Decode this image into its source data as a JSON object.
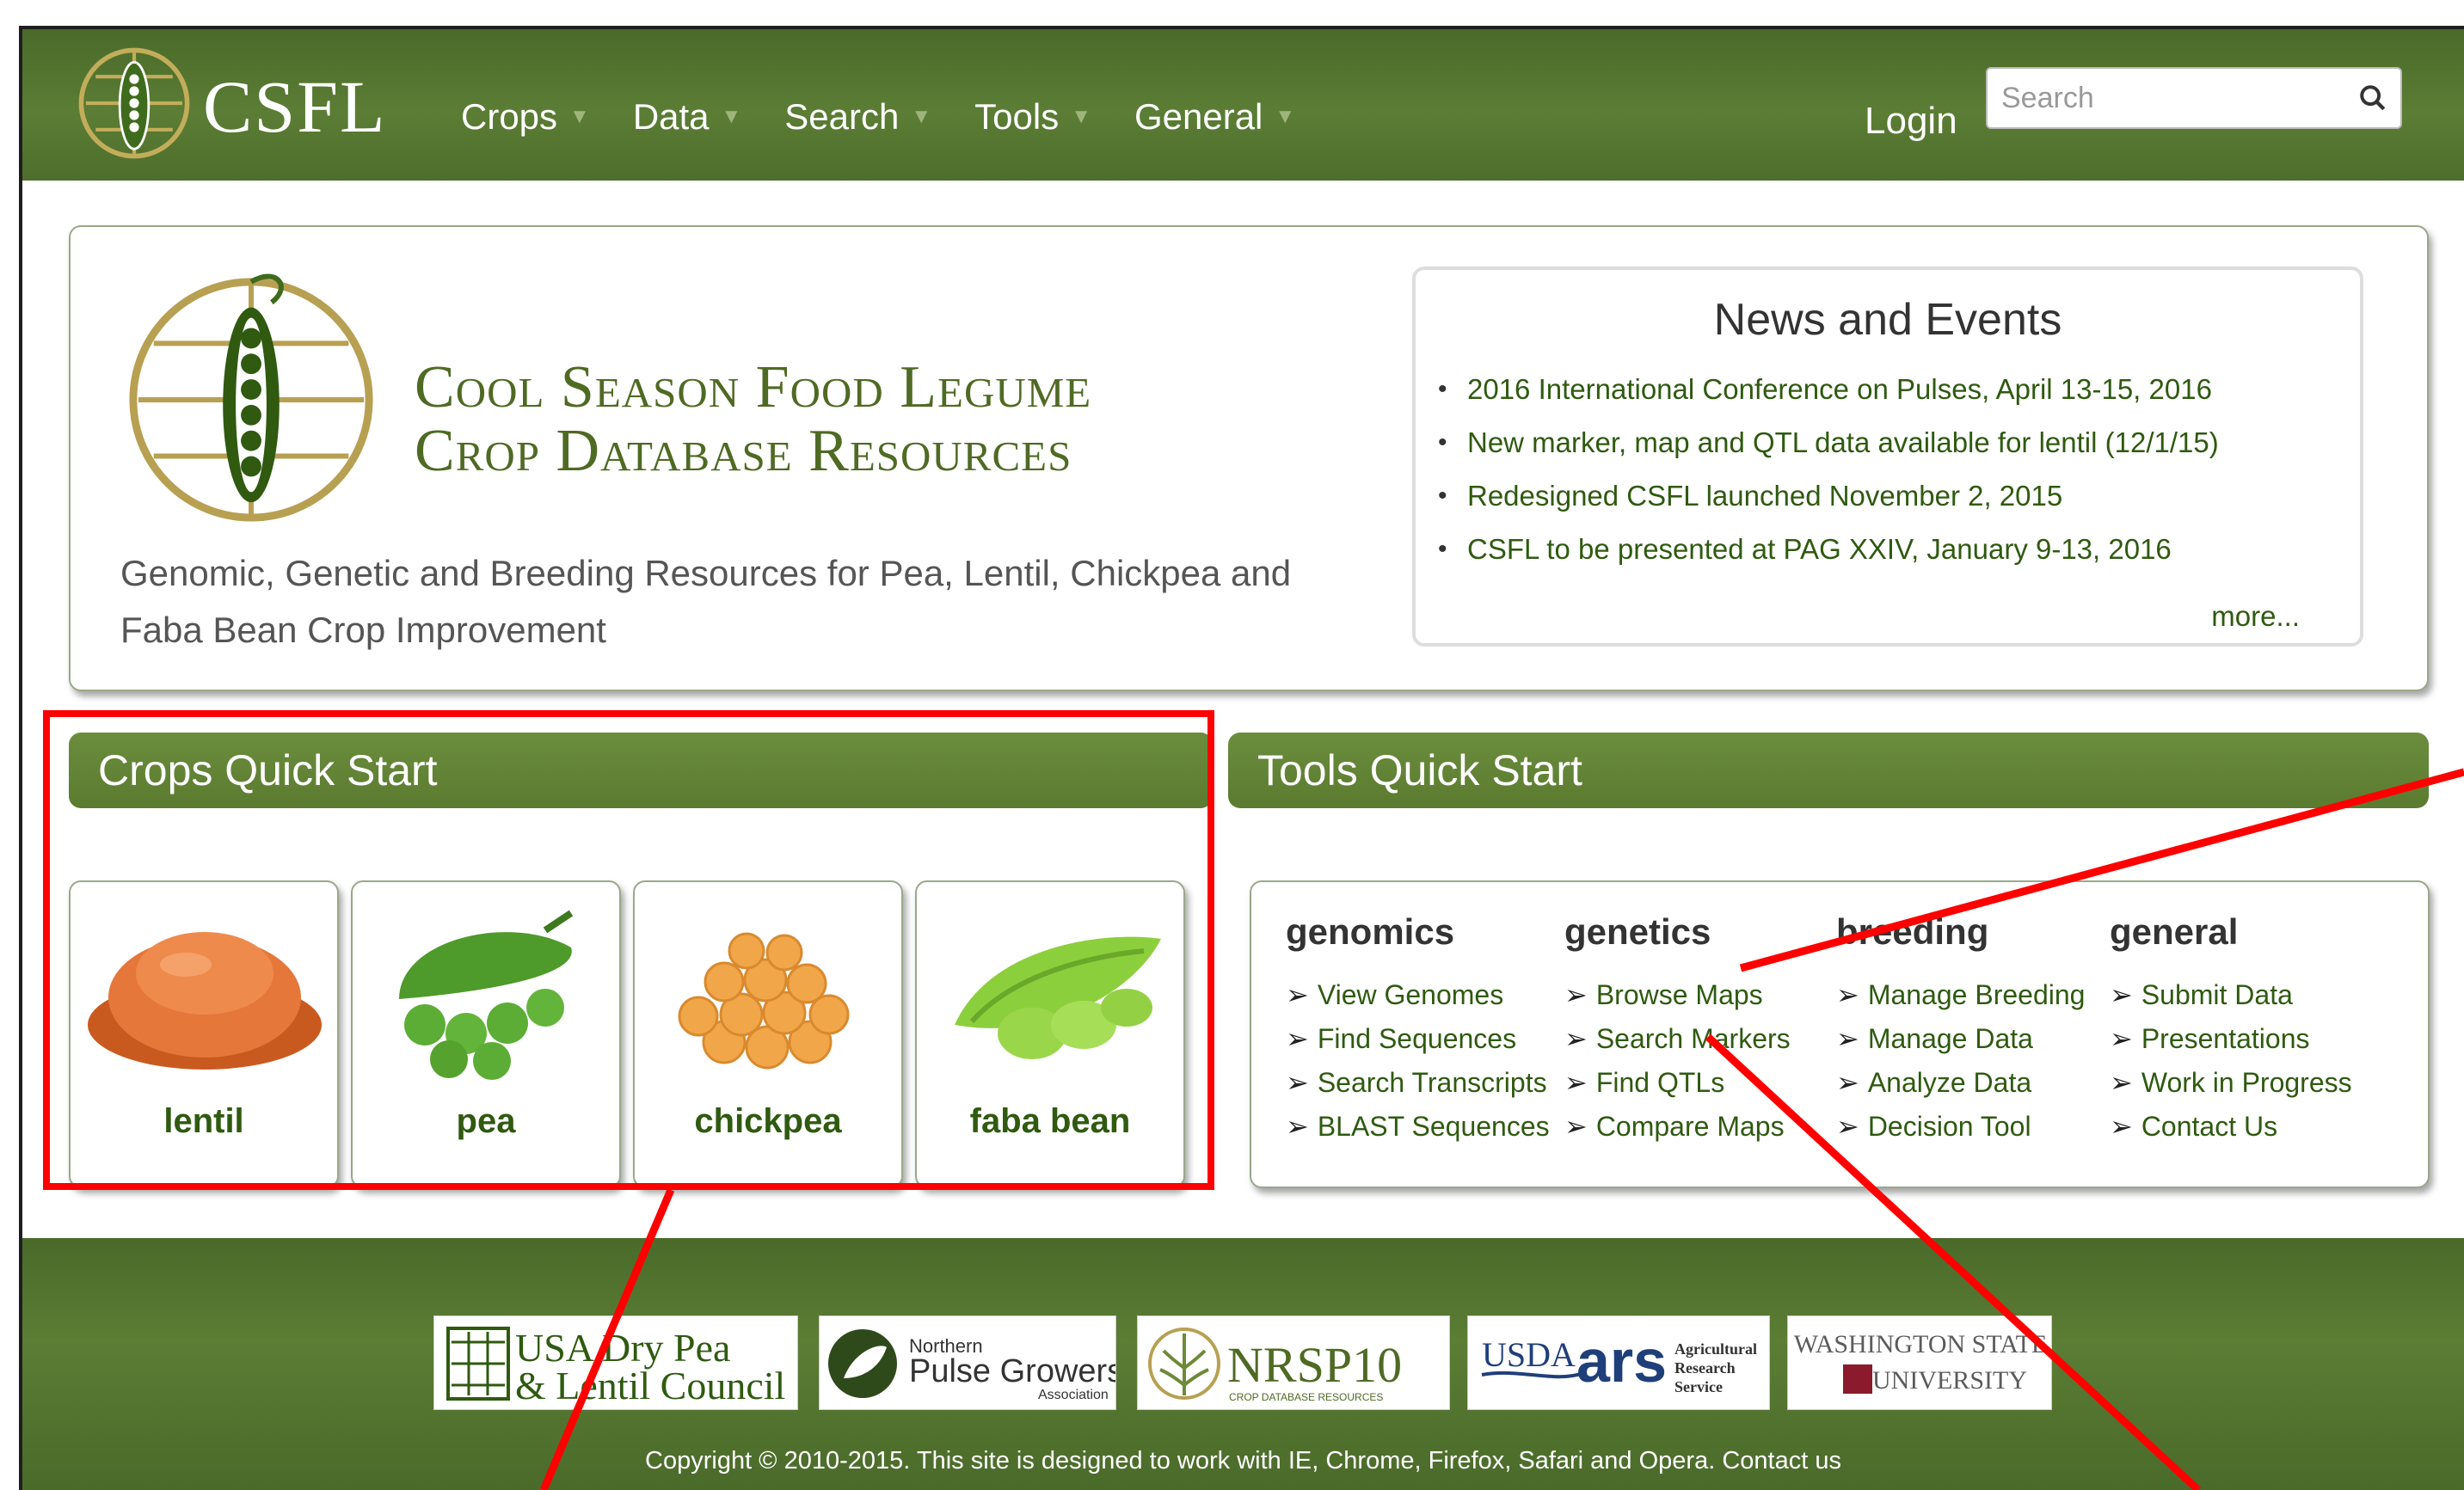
{
  "navbar": {
    "brand": "CSFL",
    "menu": [
      "Crops",
      "Data",
      "Search",
      "Tools",
      "General"
    ],
    "login": "Login",
    "search_placeholder": "Search"
  },
  "hero": {
    "title_line1": "Cool Season Food Legume",
    "title_line2": "Crop Database Resources",
    "tagline": "Genomic, Genetic and Breeding Resources for Pea, Lentil, Chickpea and Faba Bean Crop Improvement"
  },
  "news": {
    "title": "News and Events",
    "items": [
      "2016 International Conference on Pulses, April 13-15, 2016",
      "New marker, map and QTL data available for lentil (12/1/15)",
      "Redesigned CSFL launched November 2, 2015",
      "CSFL to be presented at PAG XXIV, January 9-13, 2016"
    ],
    "more": "more..."
  },
  "crops_quick_start": {
    "title": "Crops Quick Start",
    "crops": [
      "lentil",
      "pea",
      "chickpea",
      "faba bean"
    ]
  },
  "tools_quick_start": {
    "title": "Tools Quick Start",
    "columns": [
      {
        "heading": "genomics",
        "links": [
          "View Genomes",
          "Find Sequences",
          "Search Transcripts",
          "BLAST Sequences"
        ]
      },
      {
        "heading": "genetics",
        "links": [
          "Browse Maps",
          "Search Markers",
          "Find QTLs",
          "Compare Maps"
        ]
      },
      {
        "heading": "breeding",
        "links": [
          "Manage Breeding",
          "Manage Data",
          "Analyze Data",
          "Decision Tool"
        ]
      },
      {
        "heading": "general",
        "links": [
          "Submit Data",
          "Presentations",
          "Work in Progress",
          "Contact Us"
        ]
      }
    ]
  },
  "footer": {
    "sponsors": {
      "usa_pea": {
        "line1": "USA Dry Pea",
        "line2": "& Lentil Council"
      },
      "northern_pulse": {
        "small": "Northern",
        "big": "Pulse Growers",
        "tiny": "Association"
      },
      "nrsp10": {
        "text": "NRSP10",
        "sub": "CROP DATABASE RESOURCES"
      },
      "usda_ars": {
        "usda": "USDA",
        "ars": "ars",
        "l1": "Agricultural",
        "l2": "Research",
        "l3": "Service"
      },
      "wsu": {
        "line1": "WASHINGTON STATE",
        "line2": "UNIVERSITY"
      }
    },
    "copyright": "Copyright © 2010-2015. This site is designed to work with IE, Chrome, Firefox, Safari and Opera.",
    "contact": "Contact us"
  },
  "colors": {
    "nav_green": "#5b7d34",
    "link_green": "#2f5a10",
    "title_green": "#4f6a23",
    "annotation_red": "#ff0000"
  }
}
